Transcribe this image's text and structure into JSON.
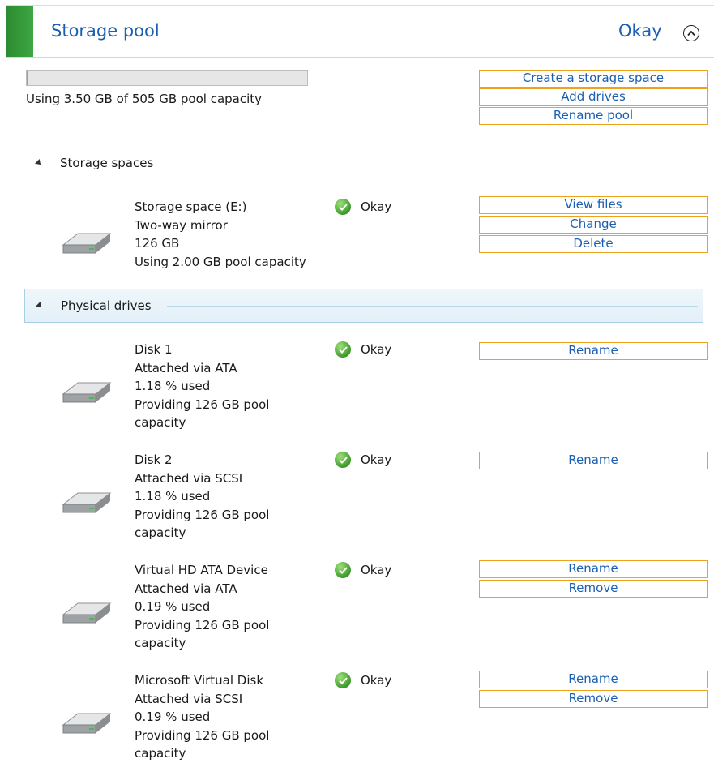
{
  "header": {
    "title": "Storage pool",
    "status": "Okay"
  },
  "pool": {
    "usage_text": "Using 3.50 GB of 505 GB pool capacity",
    "used_fraction": 0.0069
  },
  "actions": {
    "create": "Create a storage space",
    "add": "Add drives",
    "rename_pool": "Rename pool"
  },
  "storage_spaces": {
    "label": "Storage spaces",
    "items": [
      {
        "name": "Storage space (E:)",
        "type": "Two-way mirror",
        "size": "126 GB",
        "usage": "Using 2.00 GB pool capacity",
        "status": "Okay",
        "actions": [
          "View files",
          "Change",
          "Delete"
        ]
      }
    ]
  },
  "physical_drives": {
    "label": "Physical drives",
    "items": [
      {
        "name": "Disk 1",
        "attach": "Attached via ATA",
        "used": "1.18 % used",
        "providing": "Providing 126 GB pool",
        "providing2": "capacity",
        "status": "Okay",
        "actions": [
          "Rename"
        ]
      },
      {
        "name": "Disk 2",
        "attach": "Attached via SCSI",
        "used": "1.18 % used",
        "providing": "Providing 126 GB pool",
        "providing2": "capacity",
        "status": "Okay",
        "actions": [
          "Rename"
        ]
      },
      {
        "name": "Virtual HD ATA Device",
        "attach": "Attached via ATA",
        "used": "0.19 % used",
        "providing": "Providing 126 GB pool",
        "providing2": "capacity",
        "status": "Okay",
        "actions": [
          "Rename",
          "Remove"
        ]
      },
      {
        "name": "Microsoft Virtual Disk",
        "attach": "Attached via SCSI",
        "used": "0.19 % used",
        "providing": "Providing 126 GB pool",
        "providing2": "capacity",
        "status": "Okay",
        "actions": [
          "Rename",
          "Remove"
        ]
      }
    ]
  },
  "colors": {
    "accent_green": "#2a8a2f",
    "link_blue": "#1a5fb4",
    "link_border": "#f0a11c"
  }
}
